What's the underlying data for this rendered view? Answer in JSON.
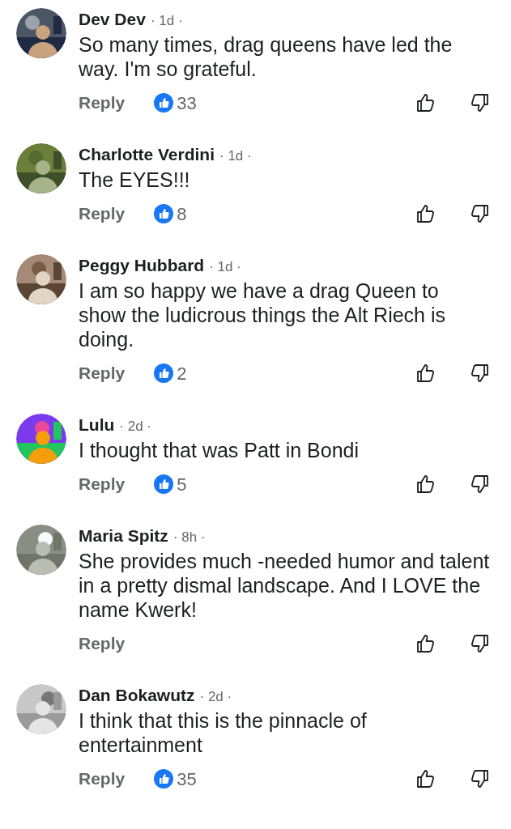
{
  "comments": [
    {
      "name": "Dev Dev",
      "time": "· 1d ·",
      "text": "So many times, drag queens have led the way. I'm so grateful.",
      "reply": "Reply",
      "likes": "33"
    },
    {
      "name": "Charlotte Verdini",
      "time": "· 1d ·",
      "text": "The EYES!!!",
      "reply": "Reply",
      "likes": "8"
    },
    {
      "name": "Peggy Hubbard",
      "time": "· 1d ·",
      "text": "I am so happy we have a drag Queen to show the ludicrous things the Alt Riech is doing.",
      "reply": "Reply",
      "likes": "2"
    },
    {
      "name": "Lulu",
      "time": "· 2d ·",
      "text": "I thought that was Patt in Bondi",
      "reply": "Reply",
      "likes": "5"
    },
    {
      "name": "Maria Spitz",
      "time": "· 8h ·",
      "text": "She provides much -needed humor and talent in a pretty dismal landscape. And I LOVE the name Kwerk!",
      "reply": "Reply"
    },
    {
      "name": "Dan Bokawutz",
      "time": "· 2d ·",
      "text": "I think that this is the pinnacle of entertainment",
      "reply": "Reply",
      "likes": "35"
    }
  ]
}
